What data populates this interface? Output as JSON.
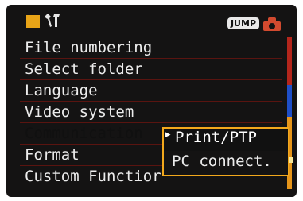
{
  "header": {
    "tool_icon": "wrench-icon",
    "jump_label": "JUMP",
    "camera_icon": "camera-icon"
  },
  "menu": {
    "items": [
      {
        "label": "File numbering"
      },
      {
        "label": "Select folder"
      },
      {
        "label": "Language"
      },
      {
        "label": "Video system"
      },
      {
        "label": "Communication"
      },
      {
        "label": "Format"
      },
      {
        "label": "Custom Functior"
      }
    ],
    "selected_index": 4
  },
  "popup": {
    "options": [
      {
        "label": "Print/PTP",
        "selected": true
      },
      {
        "label": "PC connect.",
        "selected": false
      }
    ],
    "marker": "▸"
  },
  "colors": {
    "accent": "#f2a81c",
    "tab": "#e8a417",
    "jump_bg": "#e8e8e8",
    "camera": "#d24a2f"
  }
}
